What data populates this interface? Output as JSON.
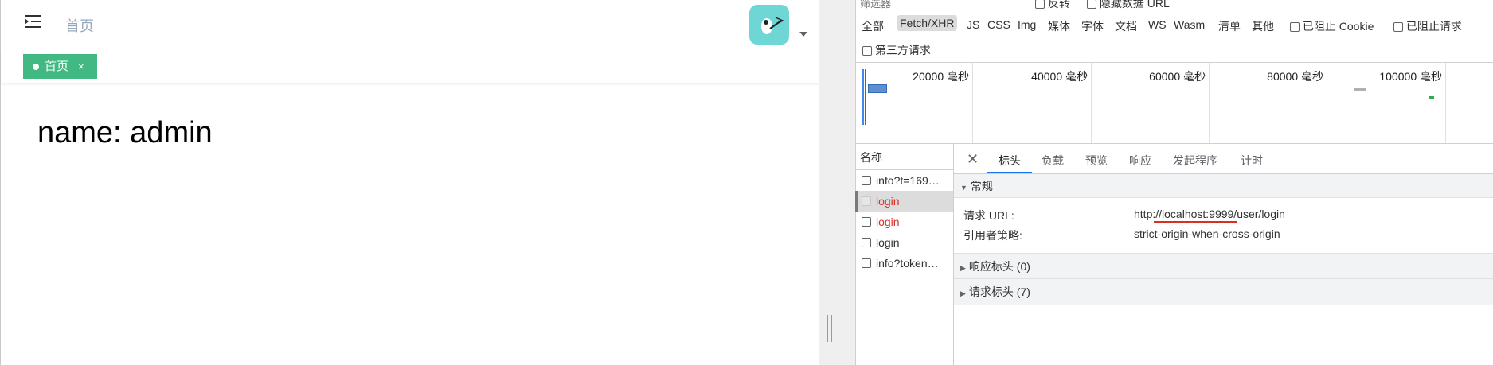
{
  "app": {
    "breadcrumb": "首页",
    "tag": {
      "label": "首页",
      "close": "×"
    },
    "content": "name: admin"
  },
  "devtools": {
    "filter_placeholder": "筛选器",
    "invert_label": "反转",
    "hide_data_url_label": "隐藏数据 URL",
    "type_filters": [
      "全部",
      "Fetch/XHR",
      "JS",
      "CSS",
      "Img",
      "媒体",
      "字体",
      "文档",
      "WS",
      "Wasm",
      "清单",
      "其他"
    ],
    "active_filter": "Fetch/XHR",
    "blocked_cookie_label": "已阻止 Cookie",
    "blocked_request_label": "已阻止请求",
    "third_party_label": "第三方请求",
    "timeline_ticks": [
      "20000 毫秒",
      "40000 毫秒",
      "60000 毫秒",
      "80000 毫秒",
      "100000 毫秒"
    ],
    "name_header": "名称",
    "requests": [
      {
        "name": "info?t=169…",
        "status": "ok"
      },
      {
        "name": "login",
        "status": "error",
        "selected": true
      },
      {
        "name": "login",
        "status": "error"
      },
      {
        "name": "login",
        "status": "ok"
      },
      {
        "name": "info?token…",
        "status": "ok"
      }
    ],
    "detail_tabs": [
      "标头",
      "负载",
      "预览",
      "响应",
      "发起程序",
      "计时"
    ],
    "active_detail_tab": "标头",
    "general_section": "常规",
    "request_url_label": "请求 URL:",
    "request_url_value": "http://localhost:9999/user/login",
    "referrer_policy_label": "引用者策略:",
    "referrer_policy_value": "strict-origin-when-cross-origin",
    "response_headers_section": "响应标头 (0)",
    "request_headers_section": "请求标头 (7)"
  },
  "colors": {
    "tag_green": "#42b983",
    "error_red": "#d93025",
    "link_blue": "#1a73e8",
    "avatar_teal": "#6fd6d6"
  }
}
